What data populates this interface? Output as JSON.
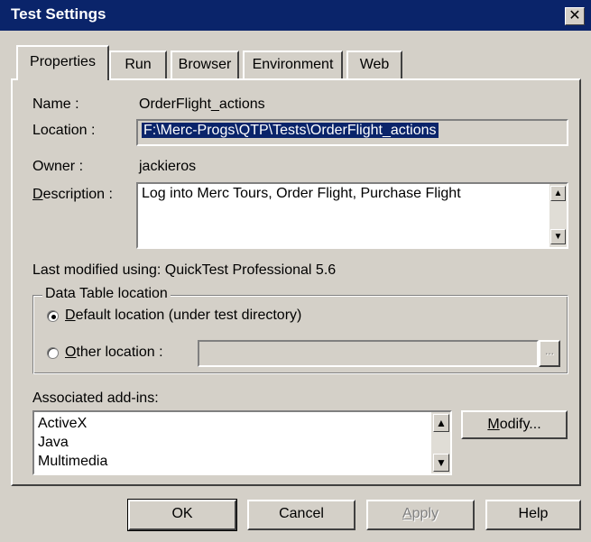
{
  "window": {
    "title": "Test Settings",
    "close_glyph": "✕"
  },
  "tabs": [
    {
      "label": "Properties"
    },
    {
      "label": "Run"
    },
    {
      "label": "Browser"
    },
    {
      "label": "Environment"
    },
    {
      "label": "Web"
    }
  ],
  "properties": {
    "name_label": "Name :",
    "name_value": "OrderFlight_actions",
    "location_label": "Location :",
    "location_value": "F:\\Merc-Progs\\QTP\\Tests\\OrderFlight_actions",
    "owner_label": "Owner :",
    "owner_value": "jackieros",
    "description_label_first": "D",
    "description_label_rest": "escription :",
    "description_value": "Log into Merc Tours, Order Flight, Purchase Flight",
    "last_modified": "Last modified using: QuickTest Professional 5.6"
  },
  "data_table": {
    "group_label": "Data Table location",
    "default_option_first": "D",
    "default_option_rest": "efault location (under test directory)",
    "other_option_first": "O",
    "other_option_rest": "ther location :",
    "other_value": "",
    "browse_label": "...",
    "selected": "default"
  },
  "addins": {
    "label": "Associated add-ins:",
    "items": [
      "ActiveX",
      "Java",
      "Multimedia"
    ],
    "modify_first": "M",
    "modify_rest": "odify..."
  },
  "buttons": {
    "ok": "OK",
    "cancel": "Cancel",
    "apply_first": "A",
    "apply_rest": "pply",
    "help": "Help"
  },
  "colors": {
    "titlebar": "#0a246a",
    "face": "#d4d0c8",
    "selection": "#0a246a"
  }
}
